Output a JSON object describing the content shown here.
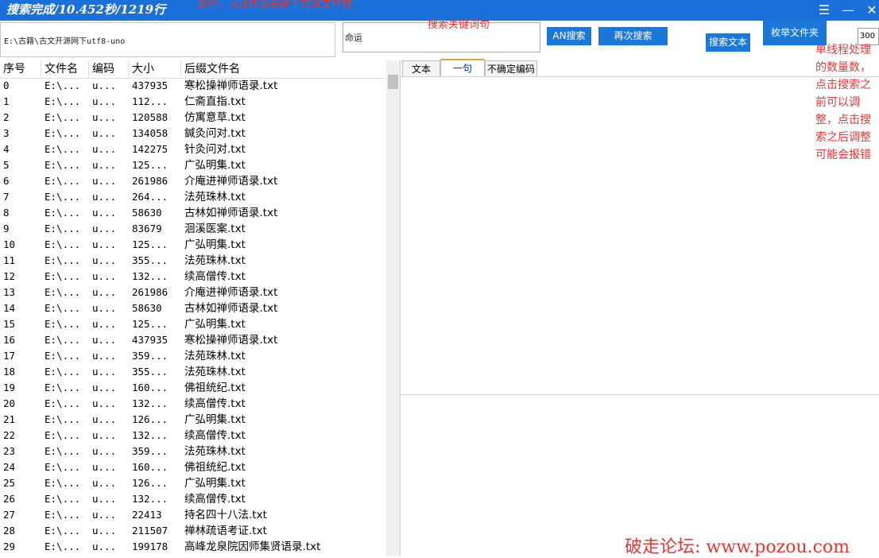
{
  "titlebar": {
    "status": "搜索完成/10.452秒/1219行",
    "overlay_note": "路径，以及包含关键字的总文件数",
    "menu_icon": "hamburger-icon",
    "minimize_icon": "minimize-icon",
    "close_icon": "close-icon"
  },
  "search": {
    "path": "E:\\古籍\\古文开源网下utf8-uno",
    "keyword": "命运",
    "keyword_note": "搜索关键词句",
    "an_search_label": "AN搜索",
    "search_again_label": "再次搜索",
    "search_text_label": "搜索文本",
    "enumerate_folder_label": "枚举文件夹",
    "thread_count": "300"
  },
  "annotation": "单线程处理的数量数，点击搜索之前可以调整，点击搜索之后调整可能会报错",
  "table": {
    "headers": [
      "序号",
      "文件名",
      "编码",
      "大小",
      "后缀文件名"
    ],
    "rows": [
      [
        "0",
        "E:\\...",
        "u...",
        "437935",
        "寒松操禅师语录.txt"
      ],
      [
        "1",
        "E:\\...",
        "u...",
        "112...",
        "仁斋直指.txt"
      ],
      [
        "2",
        "E:\\...",
        "u...",
        "120588",
        "仿寓意草.txt"
      ],
      [
        "3",
        "E:\\...",
        "u...",
        "134058",
        "鍼灸问对.txt"
      ],
      [
        "4",
        "E:\\...",
        "u...",
        "142275",
        "针灸问对.txt"
      ],
      [
        "5",
        "E:\\...",
        "u...",
        "125...",
        "广弘明集.txt"
      ],
      [
        "6",
        "E:\\...",
        "u...",
        "261986",
        "介庵进禅师语录.txt"
      ],
      [
        "7",
        "E:\\...",
        "u...",
        "264...",
        "法苑珠林.txt"
      ],
      [
        "8",
        "E:\\...",
        "u...",
        "58630",
        "古林如禅师语录.txt"
      ],
      [
        "9",
        "E:\\...",
        "u...",
        "83679",
        "洄溪医案.txt"
      ],
      [
        "10",
        "E:\\...",
        "u...",
        "125...",
        "广弘明集.txt"
      ],
      [
        "11",
        "E:\\...",
        "u...",
        "355...",
        "法苑珠林.txt"
      ],
      [
        "12",
        "E:\\...",
        "u...",
        "132...",
        "续高僧传.txt"
      ],
      [
        "13",
        "E:\\...",
        "u...",
        "261986",
        "介庵进禅师语录.txt"
      ],
      [
        "14",
        "E:\\...",
        "u...",
        "58630",
        "古林如禅师语录.txt"
      ],
      [
        "15",
        "E:\\...",
        "u...",
        "125...",
        "广弘明集.txt"
      ],
      [
        "16",
        "E:\\...",
        "u...",
        "437935",
        "寒松操禅师语录.txt"
      ],
      [
        "17",
        "E:\\...",
        "u...",
        "359...",
        "法苑珠林.txt"
      ],
      [
        "18",
        "E:\\...",
        "u...",
        "355...",
        "法苑珠林.txt"
      ],
      [
        "19",
        "E:\\...",
        "u...",
        "160...",
        "佛祖统纪.txt"
      ],
      [
        "20",
        "E:\\...",
        "u...",
        "132...",
        "续高僧传.txt"
      ],
      [
        "21",
        "E:\\...",
        "u...",
        "126...",
        "广弘明集.txt"
      ],
      [
        "22",
        "E:\\...",
        "u...",
        "132...",
        "续高僧传.txt"
      ],
      [
        "23",
        "E:\\...",
        "u...",
        "359...",
        "法苑珠林.txt"
      ],
      [
        "24",
        "E:\\...",
        "u...",
        "160...",
        "佛祖统纪.txt"
      ],
      [
        "25",
        "E:\\...",
        "u...",
        "126...",
        "广弘明集.txt"
      ],
      [
        "26",
        "E:\\...",
        "u...",
        "132...",
        "续高僧传.txt"
      ],
      [
        "27",
        "E:\\...",
        "u...",
        "22413",
        "持名四十八法.txt"
      ],
      [
        "28",
        "E:\\...",
        "u...",
        "211507",
        "禅林疏语考证.txt"
      ],
      [
        "29",
        "E:\\...",
        "u...",
        "199178",
        "高峰龙泉院因师集贤语录.txt"
      ]
    ]
  },
  "tabs": [
    {
      "label": "文本"
    },
    {
      "label": "一句"
    },
    {
      "label": "不确定编码"
    }
  ],
  "watermark": "破走论坛: www.pozou.com"
}
